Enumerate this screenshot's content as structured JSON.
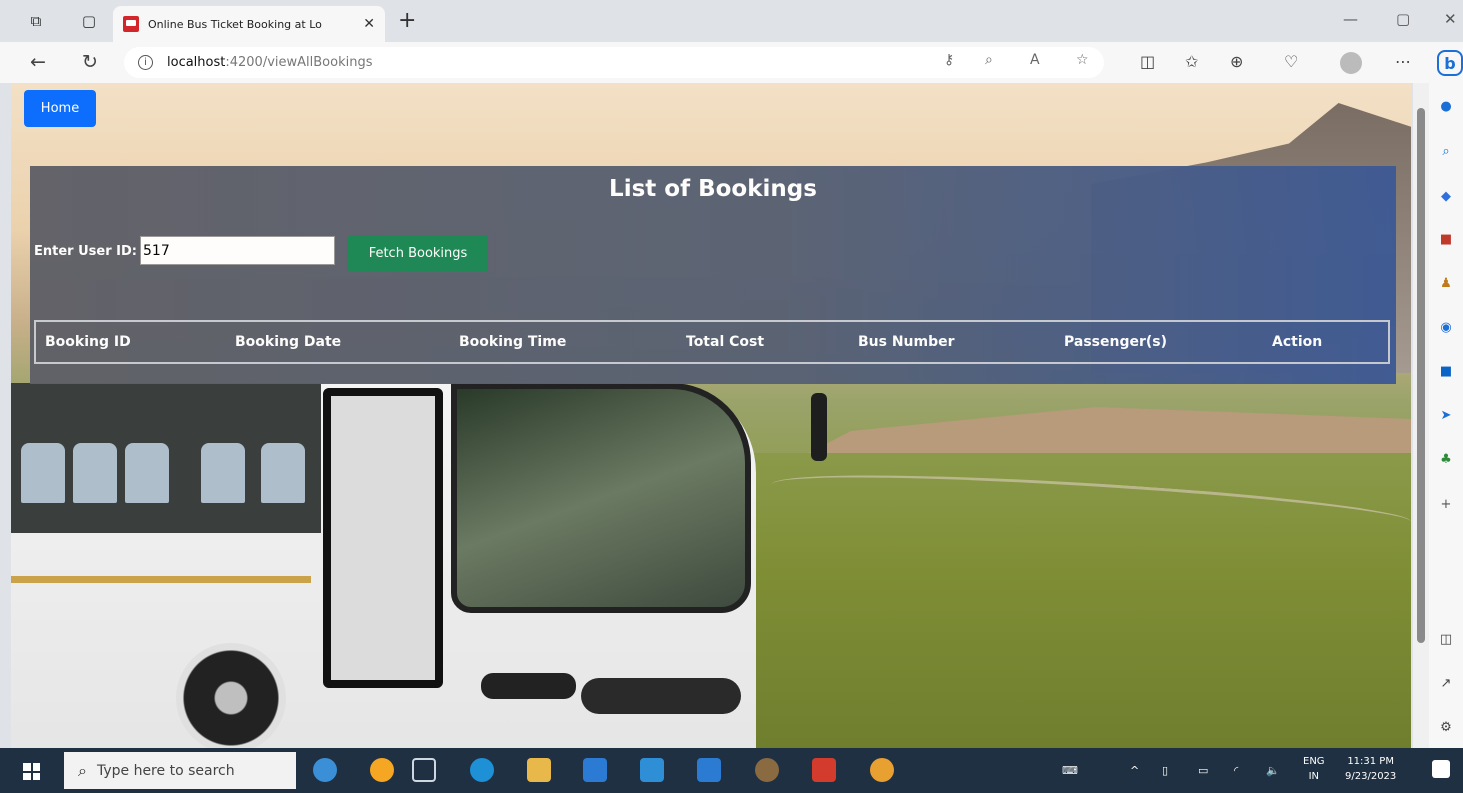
{
  "browser": {
    "tab_title": "Online Bus Ticket Booking at Lo",
    "url_host": "localhost",
    "url_path": ":4200/viewAllBookings"
  },
  "page": {
    "home_label": "Home",
    "title": "List of Bookings",
    "user_id_label": "Enter User ID:",
    "user_id_value": "517",
    "fetch_label": "Fetch Bookings",
    "table_headers": [
      "Booking ID",
      "Booking Date",
      "Booking Time",
      "Total Cost",
      "Bus Number",
      "Passenger(s)",
      "Action"
    ]
  },
  "taskbar": {
    "search_placeholder": "Type here to search",
    "lang_top": "ENG",
    "lang_bottom": "IN",
    "time": "11:31 PM",
    "date": "9/23/2023"
  },
  "colors": {
    "home_button": "#0d6efd",
    "fetch_button": "#198754",
    "taskbar": "#1f3042"
  },
  "icons": {
    "back": "arrow-left-icon",
    "refresh": "refresh-icon",
    "info": "info-icon",
    "new_tab": "plus-icon",
    "close_tab": "close-icon"
  }
}
